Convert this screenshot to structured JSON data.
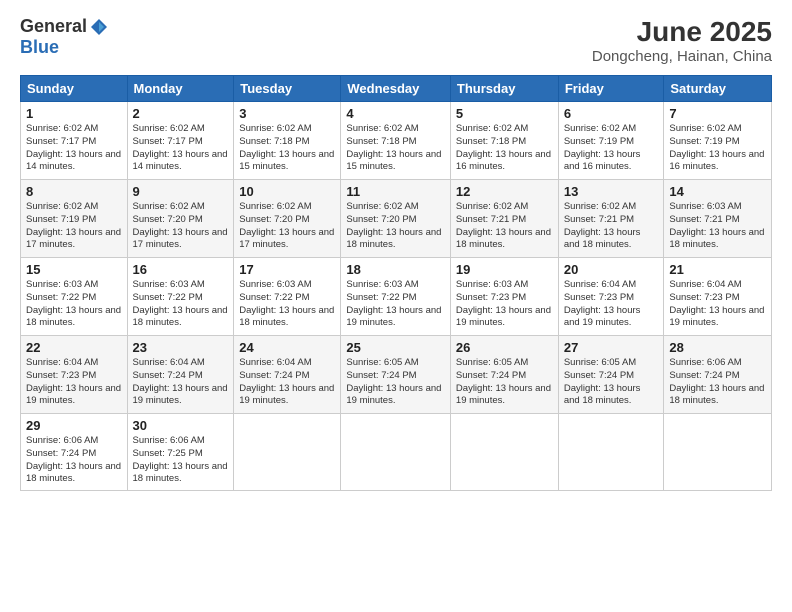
{
  "header": {
    "logo_general": "General",
    "logo_blue": "Blue",
    "month_title": "June 2025",
    "location": "Dongcheng, Hainan, China"
  },
  "days_of_week": [
    "Sunday",
    "Monday",
    "Tuesday",
    "Wednesday",
    "Thursday",
    "Friday",
    "Saturday"
  ],
  "weeks": [
    [
      {
        "day": "1",
        "sunrise": "6:02 AM",
        "sunset": "7:17 PM",
        "daylight": "13 hours and 14 minutes."
      },
      {
        "day": "2",
        "sunrise": "6:02 AM",
        "sunset": "7:17 PM",
        "daylight": "13 hours and 14 minutes."
      },
      {
        "day": "3",
        "sunrise": "6:02 AM",
        "sunset": "7:18 PM",
        "daylight": "13 hours and 15 minutes."
      },
      {
        "day": "4",
        "sunrise": "6:02 AM",
        "sunset": "7:18 PM",
        "daylight": "13 hours and 15 minutes."
      },
      {
        "day": "5",
        "sunrise": "6:02 AM",
        "sunset": "7:18 PM",
        "daylight": "13 hours and 16 minutes."
      },
      {
        "day": "6",
        "sunrise": "6:02 AM",
        "sunset": "7:19 PM",
        "daylight": "13 hours and 16 minutes."
      },
      {
        "day": "7",
        "sunrise": "6:02 AM",
        "sunset": "7:19 PM",
        "daylight": "13 hours and 16 minutes."
      }
    ],
    [
      {
        "day": "8",
        "sunrise": "6:02 AM",
        "sunset": "7:19 PM",
        "daylight": "13 hours and 17 minutes."
      },
      {
        "day": "9",
        "sunrise": "6:02 AM",
        "sunset": "7:20 PM",
        "daylight": "13 hours and 17 minutes."
      },
      {
        "day": "10",
        "sunrise": "6:02 AM",
        "sunset": "7:20 PM",
        "daylight": "13 hours and 17 minutes."
      },
      {
        "day": "11",
        "sunrise": "6:02 AM",
        "sunset": "7:20 PM",
        "daylight": "13 hours and 18 minutes."
      },
      {
        "day": "12",
        "sunrise": "6:02 AM",
        "sunset": "7:21 PM",
        "daylight": "13 hours and 18 minutes."
      },
      {
        "day": "13",
        "sunrise": "6:02 AM",
        "sunset": "7:21 PM",
        "daylight": "13 hours and 18 minutes."
      },
      {
        "day": "14",
        "sunrise": "6:03 AM",
        "sunset": "7:21 PM",
        "daylight": "13 hours and 18 minutes."
      }
    ],
    [
      {
        "day": "15",
        "sunrise": "6:03 AM",
        "sunset": "7:22 PM",
        "daylight": "13 hours and 18 minutes."
      },
      {
        "day": "16",
        "sunrise": "6:03 AM",
        "sunset": "7:22 PM",
        "daylight": "13 hours and 18 minutes."
      },
      {
        "day": "17",
        "sunrise": "6:03 AM",
        "sunset": "7:22 PM",
        "daylight": "13 hours and 18 minutes."
      },
      {
        "day": "18",
        "sunrise": "6:03 AM",
        "sunset": "7:22 PM",
        "daylight": "13 hours and 19 minutes."
      },
      {
        "day": "19",
        "sunrise": "6:03 AM",
        "sunset": "7:23 PM",
        "daylight": "13 hours and 19 minutes."
      },
      {
        "day": "20",
        "sunrise": "6:04 AM",
        "sunset": "7:23 PM",
        "daylight": "13 hours and 19 minutes."
      },
      {
        "day": "21",
        "sunrise": "6:04 AM",
        "sunset": "7:23 PM",
        "daylight": "13 hours and 19 minutes."
      }
    ],
    [
      {
        "day": "22",
        "sunrise": "6:04 AM",
        "sunset": "7:23 PM",
        "daylight": "13 hours and 19 minutes."
      },
      {
        "day": "23",
        "sunrise": "6:04 AM",
        "sunset": "7:24 PM",
        "daylight": "13 hours and 19 minutes."
      },
      {
        "day": "24",
        "sunrise": "6:04 AM",
        "sunset": "7:24 PM",
        "daylight": "13 hours and 19 minutes."
      },
      {
        "day": "25",
        "sunrise": "6:05 AM",
        "sunset": "7:24 PM",
        "daylight": "13 hours and 19 minutes."
      },
      {
        "day": "26",
        "sunrise": "6:05 AM",
        "sunset": "7:24 PM",
        "daylight": "13 hours and 19 minutes."
      },
      {
        "day": "27",
        "sunrise": "6:05 AM",
        "sunset": "7:24 PM",
        "daylight": "13 hours and 18 minutes."
      },
      {
        "day": "28",
        "sunrise": "6:06 AM",
        "sunset": "7:24 PM",
        "daylight": "13 hours and 18 minutes."
      }
    ],
    [
      {
        "day": "29",
        "sunrise": "6:06 AM",
        "sunset": "7:24 PM",
        "daylight": "13 hours and 18 minutes."
      },
      {
        "day": "30",
        "sunrise": "6:06 AM",
        "sunset": "7:25 PM",
        "daylight": "13 hours and 18 minutes."
      },
      null,
      null,
      null,
      null,
      null
    ]
  ]
}
